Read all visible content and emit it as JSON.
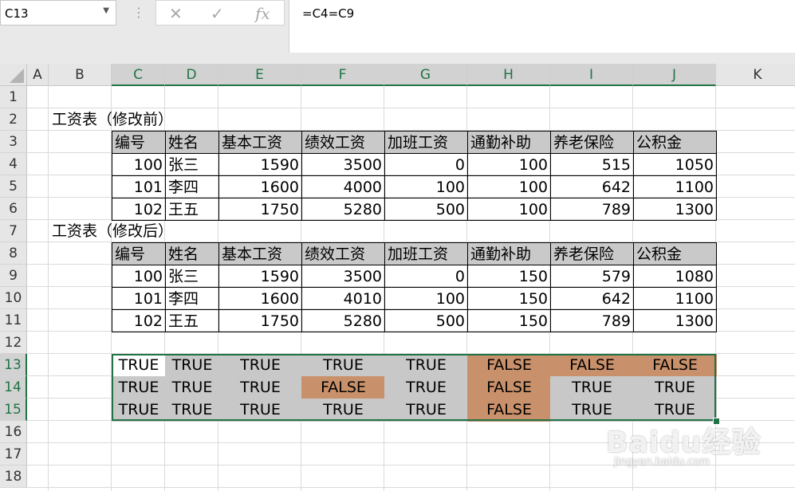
{
  "name_box": "C13",
  "formula": "=C4=C9",
  "toolbar": {
    "cancel": "✕",
    "enter": "✓",
    "fx": "fx"
  },
  "columns": [
    "A",
    "B",
    "C",
    "D",
    "E",
    "F",
    "G",
    "H",
    "I",
    "J",
    "K"
  ],
  "rows": [
    "1",
    "2",
    "3",
    "4",
    "5",
    "6",
    "7",
    "8",
    "9",
    "10",
    "11",
    "12",
    "13",
    "14",
    "15",
    "16",
    "17",
    "18"
  ],
  "table1": {
    "title": "工资表（修改前）",
    "headers": [
      "编号",
      "姓名",
      "基本工资",
      "绩效工资",
      "加班工资",
      "通勤补助",
      "养老保险",
      "公积金"
    ],
    "rows": [
      [
        "100",
        "张三",
        "1590",
        "3500",
        "0",
        "100",
        "515",
        "1050"
      ],
      [
        "101",
        "李四",
        "1600",
        "4000",
        "100",
        "100",
        "642",
        "1100"
      ],
      [
        "102",
        "王五",
        "1750",
        "5280",
        "500",
        "100",
        "789",
        "1300"
      ]
    ]
  },
  "table2": {
    "title": "工资表（修改后）",
    "headers": [
      "编号",
      "姓名",
      "基本工资",
      "绩效工资",
      "加班工资",
      "通勤补助",
      "养老保险",
      "公积金"
    ],
    "rows": [
      [
        "100",
        "张三",
        "1590",
        "3500",
        "0",
        "150",
        "579",
        "1080"
      ],
      [
        "101",
        "李四",
        "1600",
        "4010",
        "100",
        "150",
        "642",
        "1100"
      ],
      [
        "102",
        "王五",
        "1750",
        "5280",
        "500",
        "150",
        "789",
        "1300"
      ]
    ]
  },
  "compare": {
    "rows": [
      [
        "TRUE",
        "TRUE",
        "TRUE",
        "TRUE",
        "TRUE",
        "FALSE",
        "FALSE",
        "FALSE"
      ],
      [
        "TRUE",
        "TRUE",
        "TRUE",
        "FALSE",
        "TRUE",
        "FALSE",
        "TRUE",
        "TRUE"
      ],
      [
        "TRUE",
        "TRUE",
        "TRUE",
        "TRUE",
        "TRUE",
        "FALSE",
        "TRUE",
        "TRUE"
      ]
    ]
  },
  "colors": {
    "header_fill": "#c9c9c9",
    "compare_fill": "#c8c8c8",
    "false_fill": "#c9916b",
    "selection": "#217346"
  },
  "watermark": {
    "logo": "Baidu经验",
    "url": "jingyan.baidu.com"
  }
}
